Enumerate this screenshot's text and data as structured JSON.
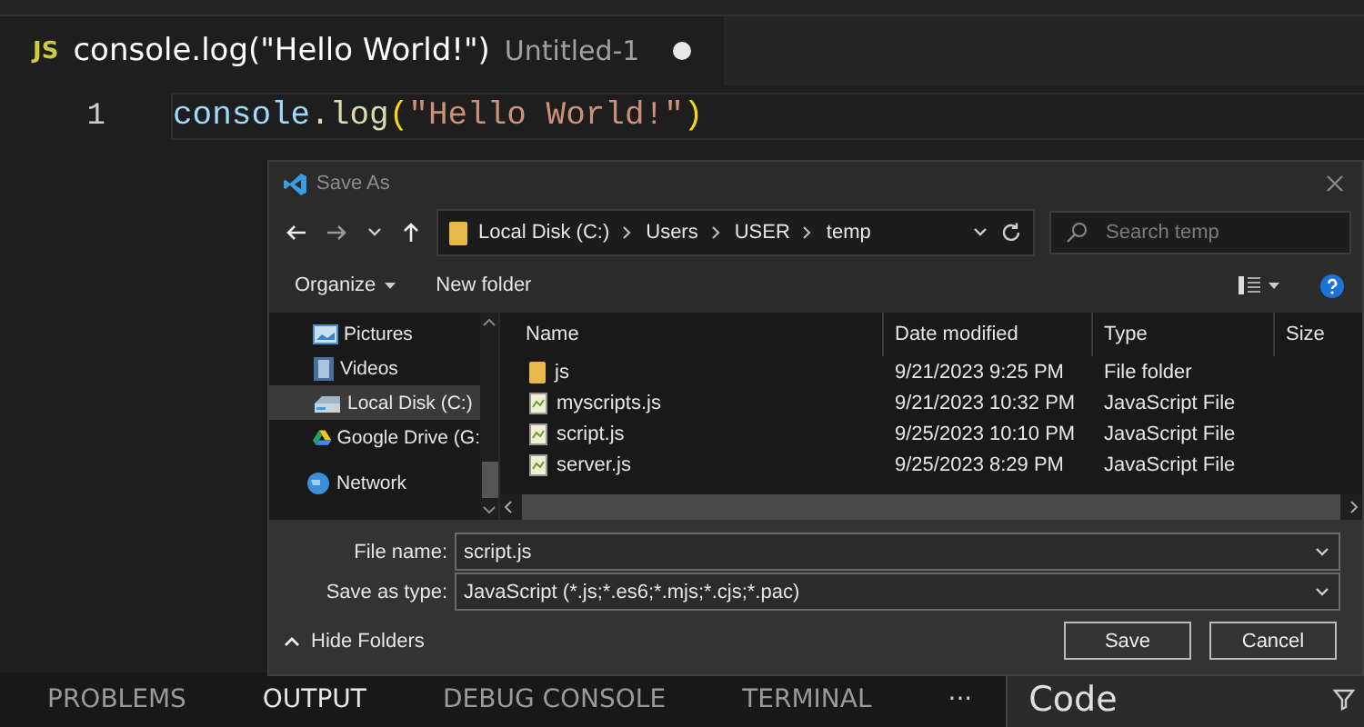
{
  "editor": {
    "tab": {
      "badge": "JS",
      "title": "console.log(\"Hello World!\")",
      "description": "Untitled-1",
      "dirty": true
    },
    "lines": [
      {
        "number": "1",
        "tokens": [
          {
            "kind": "variable",
            "text": "console"
          },
          {
            "kind": "plain",
            "text": ".log"
          },
          {
            "kind": "bracket",
            "text": "("
          },
          {
            "kind": "string",
            "text": "\"Hello World!\""
          },
          {
            "kind": "bracket",
            "text": ")"
          }
        ]
      }
    ]
  },
  "dialog": {
    "title": "Save As",
    "address": {
      "crumbs": [
        "Local Disk (C:)",
        "Users",
        "USER",
        "temp"
      ]
    },
    "search": {
      "placeholder": "Search temp"
    },
    "toolbar": {
      "organize": "Organize",
      "new_folder": "New folder"
    },
    "sidebar": {
      "items": [
        {
          "kind": "pictures",
          "label": "Pictures",
          "selected": false
        },
        {
          "kind": "videos",
          "label": "Videos",
          "selected": false
        },
        {
          "kind": "disk",
          "label": "Local Disk (C:)",
          "selected": true
        },
        {
          "kind": "cloud",
          "label": "Google Drive (G:",
          "selected": false
        },
        {
          "kind": "network",
          "label": "Network",
          "selected": false
        }
      ]
    },
    "table": {
      "columns": [
        "Name",
        "Date modified",
        "Type",
        "Size"
      ],
      "rows": [
        {
          "kind": "folder",
          "name": "js",
          "date": "9/21/2023 9:25 PM",
          "type": "File folder"
        },
        {
          "kind": "file",
          "name": "myscripts.js",
          "date": "9/21/2023 10:32 PM",
          "type": "JavaScript File"
        },
        {
          "kind": "file",
          "name": "script.js",
          "date": "9/25/2023 10:10 PM",
          "type": "JavaScript File"
        },
        {
          "kind": "file",
          "name": "server.js",
          "date": "9/25/2023 8:29 PM",
          "type": "JavaScript File"
        }
      ]
    },
    "fields": [
      {
        "label": "File name:",
        "value": "script.js"
      },
      {
        "label": "Save as type:",
        "value": "JavaScript (*.js;*.es6;*.mjs;*.cjs;*.pac)"
      }
    ],
    "hide_folders": "Hide Folders",
    "buttons": [
      "Save",
      "Cancel"
    ]
  },
  "panel": {
    "tabs": [
      {
        "label": "PROBLEMS",
        "selected": false
      },
      {
        "label": "OUTPUT",
        "selected": true
      },
      {
        "label": "DEBUG CONSOLE",
        "selected": false
      },
      {
        "label": "TERMINAL",
        "selected": false
      }
    ],
    "more": "···",
    "input_value": "Code"
  }
}
